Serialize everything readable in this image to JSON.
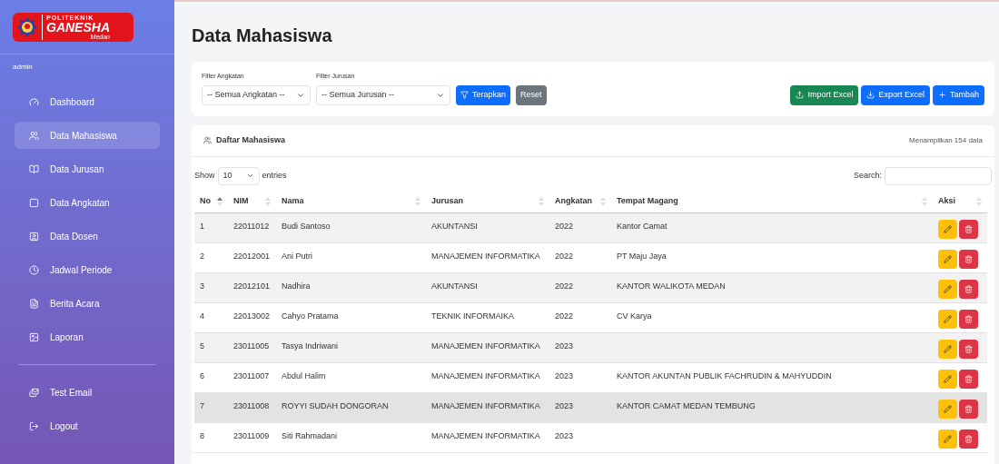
{
  "logo": {
    "top": "POLITEKNIK",
    "main": "GANESHA",
    "sub": "Medan"
  },
  "user": "admin",
  "sidebar": {
    "items": [
      {
        "label": "Dashboard",
        "selected": false
      },
      {
        "label": "Data Mahasiswa",
        "selected": true
      },
      {
        "label": "Data Jurusan",
        "selected": false
      },
      {
        "label": "Data Angkatan",
        "selected": false
      },
      {
        "label": "Data Dosen",
        "selected": false
      },
      {
        "label": "Jadwal Periode",
        "selected": false
      },
      {
        "label": "Berita Acara",
        "selected": false
      },
      {
        "label": "Laporan",
        "selected": false
      }
    ],
    "footer_items": [
      {
        "label": "Test Email",
        "selected": false
      },
      {
        "label": "Logout",
        "selected": false
      }
    ]
  },
  "page_title": "Data Mahasiswa",
  "filters": [
    {
      "label": "Filter Angkatan",
      "value": "-- Semua Angkatan --"
    },
    {
      "label": "Filter Jurusan",
      "value": "-- Semua Jurusan --"
    }
  ],
  "filter_buttons": [
    {
      "label": "Terapkan",
      "kind": "primary"
    },
    {
      "label": "Reset",
      "kind": "secondary"
    }
  ],
  "actions": [
    {
      "label": "Import Excel",
      "kind": "success"
    },
    {
      "label": "Export Excel",
      "kind": "primary"
    },
    {
      "label": "Tambah",
      "kind": "primary"
    }
  ],
  "card": {
    "title": "Daftar Mahasiswa",
    "count": "Menampilkan 154 data"
  },
  "length": {
    "before": "Show",
    "value": "10",
    "after": "entries"
  },
  "search": {
    "label": "Search:"
  },
  "table": {
    "columns": [
      {
        "label": "No",
        "sorted": true
      },
      {
        "label": "NIM",
        "sorted": false
      },
      {
        "label": "Nama",
        "sorted": false
      },
      {
        "label": "Jurusan",
        "sorted": false
      },
      {
        "label": "Angkatan",
        "sorted": false
      },
      {
        "label": "Tempat Magang",
        "sorted": false
      },
      {
        "label": "Aksi",
        "sorted": false
      }
    ],
    "rows": [
      {
        "cells": [
          "1",
          "22011012",
          "Budi Santoso",
          "AKUNTANSI",
          "2022",
          "Kantor Camat"
        ],
        "hovered": false
      },
      {
        "cells": [
          "2",
          "22012001",
          "Ani Putri",
          "MANAJEMEN INFORMATIKA",
          "2022",
          "PT Maju Jaya"
        ],
        "hovered": false
      },
      {
        "cells": [
          "3",
          "22012101",
          "Nadhira",
          "AKUNTANSI",
          "2022",
          "KANTOR WALIKOTA MEDAN"
        ],
        "hovered": false
      },
      {
        "cells": [
          "4",
          "22013002",
          "Cahyo Pratama",
          "TEKNIK INFORMAIKA",
          "2022",
          "CV Karya"
        ],
        "hovered": false
      },
      {
        "cells": [
          "5",
          "23011005",
          "Tasya Indriwani",
          "MANAJEMEN INFORMATIKA",
          "2023"
        ],
        "hovered": false
      },
      {
        "cells": [
          "6",
          "23011007",
          "Abdul Halim",
          "MANAJEMEN INFORMATIKA",
          "2023",
          "KANTOR AKUNTAN PUBLIK FACHRUDIN & MAHYUDDIN"
        ],
        "hovered": false
      },
      {
        "cells": [
          "7",
          "23011008",
          "ROYYI SUDAH DONGORAN",
          "MANAJEMEN INFORMATIKA",
          "2023",
          "KANTOR CAMAT MEDAN TEMBUNG"
        ],
        "hovered": true
      },
      {
        "cells": [
          "8",
          "23011009",
          "Siti Rahmadani",
          "MANAJEMEN INFORMATIKA",
          "2023"
        ],
        "hovered": false
      }
    ]
  }
}
